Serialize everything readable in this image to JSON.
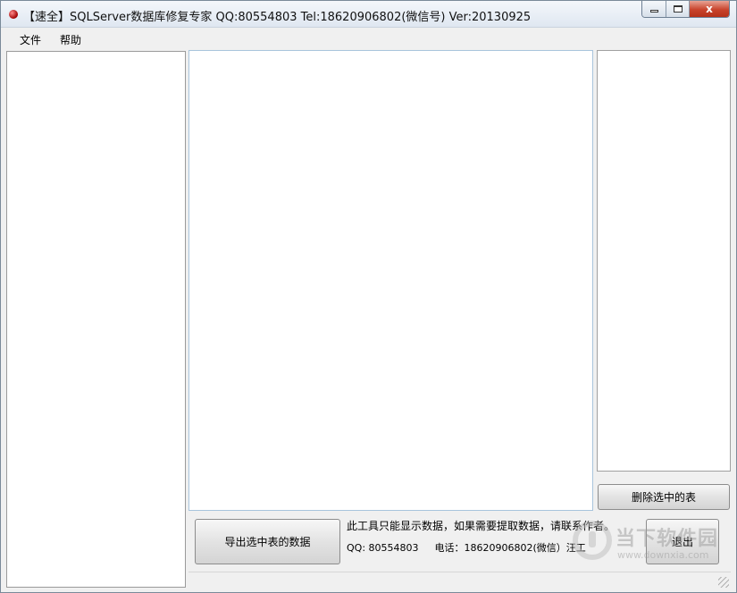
{
  "window": {
    "title": "【速全】SQLServer数据库修复专家    QQ:80554803 Tel:18620906802(微信号)  Ver:20130925",
    "close_glyph": "x",
    "colors": {
      "close": "#c8432b",
      "titlebar": "#dfe7f1",
      "icon": "#a00000"
    }
  },
  "menu": {
    "file": "文件",
    "help": "帮助"
  },
  "buttons": {
    "delete_selected": "删除选中的表",
    "export_selected": "导出选中表的数据",
    "exit": "退出"
  },
  "info": {
    "line1": "此工具只能显示数据，如果需要提取数据，请联系作者。",
    "qq": "QQ: 80554803",
    "phone": "电话：18620906802(微信）汪工"
  },
  "watermark": {
    "text": "当下软件园",
    "url": "www.downxia.com"
  },
  "icons": [
    "app-icon",
    "minimize-icon",
    "maximize-icon",
    "close-icon",
    "resize-grip-icon"
  ]
}
